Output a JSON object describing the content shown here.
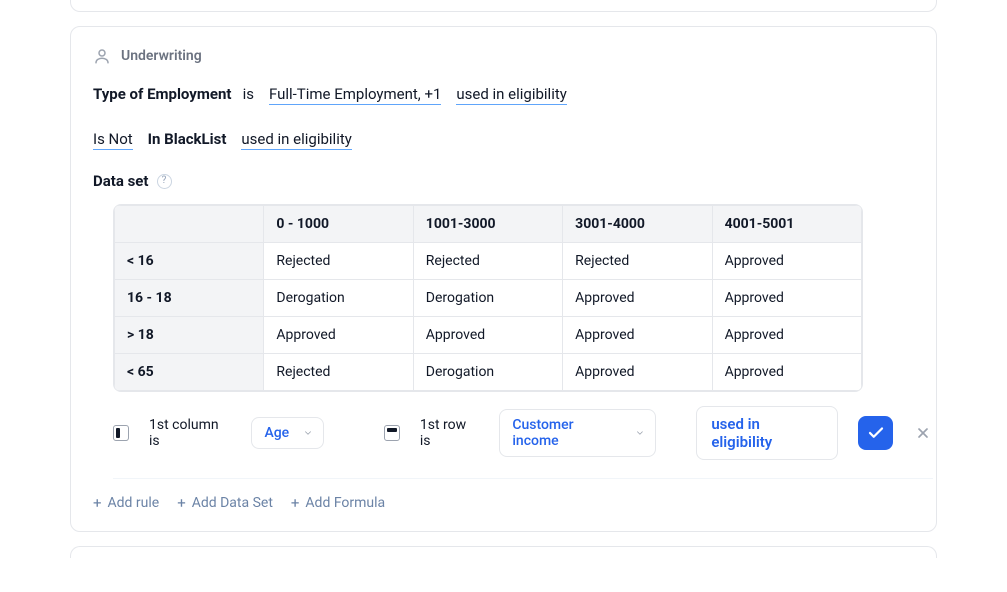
{
  "section": {
    "title": "Underwriting"
  },
  "rules": {
    "line1": {
      "field": "Type of Employment",
      "op": "is",
      "value": "Full-Time Employment, +1",
      "usage": "used in eligibility"
    },
    "line2": {
      "op": "Is Not",
      "field": "In BlackList",
      "usage": "used in eligibility"
    }
  },
  "dataset": {
    "label": "Data set",
    "columns": [
      "0 - 1000",
      "1001-3000",
      "3001-4000",
      "4001-5001"
    ],
    "rows": [
      {
        "head": "< 16",
        "cells": [
          "Rejected",
          "Rejected",
          "Rejected",
          "Approved"
        ]
      },
      {
        "head": "16 - 18",
        "cells": [
          "Derogation",
          "Derogation",
          "Approved",
          "Approved"
        ]
      },
      {
        "head": "> 18",
        "cells": [
          "Approved",
          "Approved",
          "Approved",
          "Approved"
        ]
      },
      {
        "head": "< 65",
        "cells": [
          "Rejected",
          "Derogation",
          "Approved",
          "Approved"
        ]
      }
    ]
  },
  "config": {
    "col_label": "1st column is",
    "col_value": "Age",
    "row_label": "1st row is",
    "row_value": "Customer income",
    "usage": "used in eligibility"
  },
  "actions": {
    "add_rule": "Add rule",
    "add_dataset": "Add Data Set",
    "add_formula": "Add Formula"
  }
}
